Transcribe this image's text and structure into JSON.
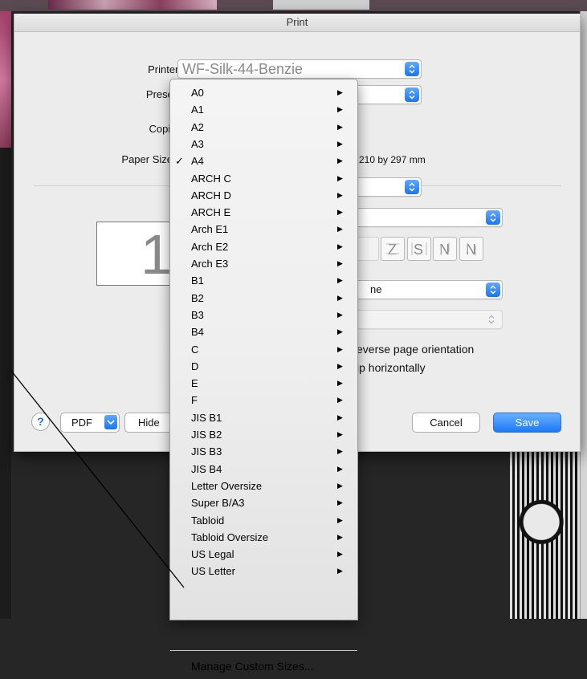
{
  "dialog": {
    "title": "Print"
  },
  "printer": {
    "label": "Printer:",
    "value": "WF-Silk-44-Benzie"
  },
  "presets": {
    "label": "Presets"
  },
  "copies": {
    "label": "Copies"
  },
  "paper_size": {
    "label": "Paper Size",
    "dimensions": "210 by 297 mm"
  },
  "preview": {
    "page_number": "1"
  },
  "options": {
    "reverse_orientation": "everse page orientation",
    "flip_horizontally": "ip horizontally",
    "layout_field_partial": "ne"
  },
  "buttons": {
    "help": "?",
    "pdf": "PDF",
    "hide_details": "Hide",
    "cancel": "Cancel",
    "save": "Save"
  },
  "menu": {
    "items": [
      {
        "label": "A0"
      },
      {
        "label": "A1"
      },
      {
        "label": "A2"
      },
      {
        "label": "A3"
      },
      {
        "label": "A4",
        "checked": true
      },
      {
        "label": "ARCH C"
      },
      {
        "label": "ARCH D"
      },
      {
        "label": "ARCH E"
      },
      {
        "label": "Arch E1"
      },
      {
        "label": "Arch E2"
      },
      {
        "label": "Arch E3"
      },
      {
        "label": "B1"
      },
      {
        "label": "B2"
      },
      {
        "label": "B3"
      },
      {
        "label": "B4"
      },
      {
        "label": "C"
      },
      {
        "label": "D"
      },
      {
        "label": "E"
      },
      {
        "label": "F"
      },
      {
        "label": "JIS B1"
      },
      {
        "label": "JIS B2"
      },
      {
        "label": "JIS B3"
      },
      {
        "label": "JIS B4"
      },
      {
        "label": "Letter Oversize"
      },
      {
        "label": "Super B/A3"
      },
      {
        "label": "Tabloid"
      },
      {
        "label": "Tabloid Oversize"
      },
      {
        "label": "US Legal"
      },
      {
        "label": "US Letter"
      }
    ],
    "check_glyph": "✓",
    "arrow_glyph": "▶",
    "footer": "Manage Custom Sizes..."
  },
  "colors": {
    "accent": "#1d79f4",
    "dialog_bg": "#ececec"
  }
}
